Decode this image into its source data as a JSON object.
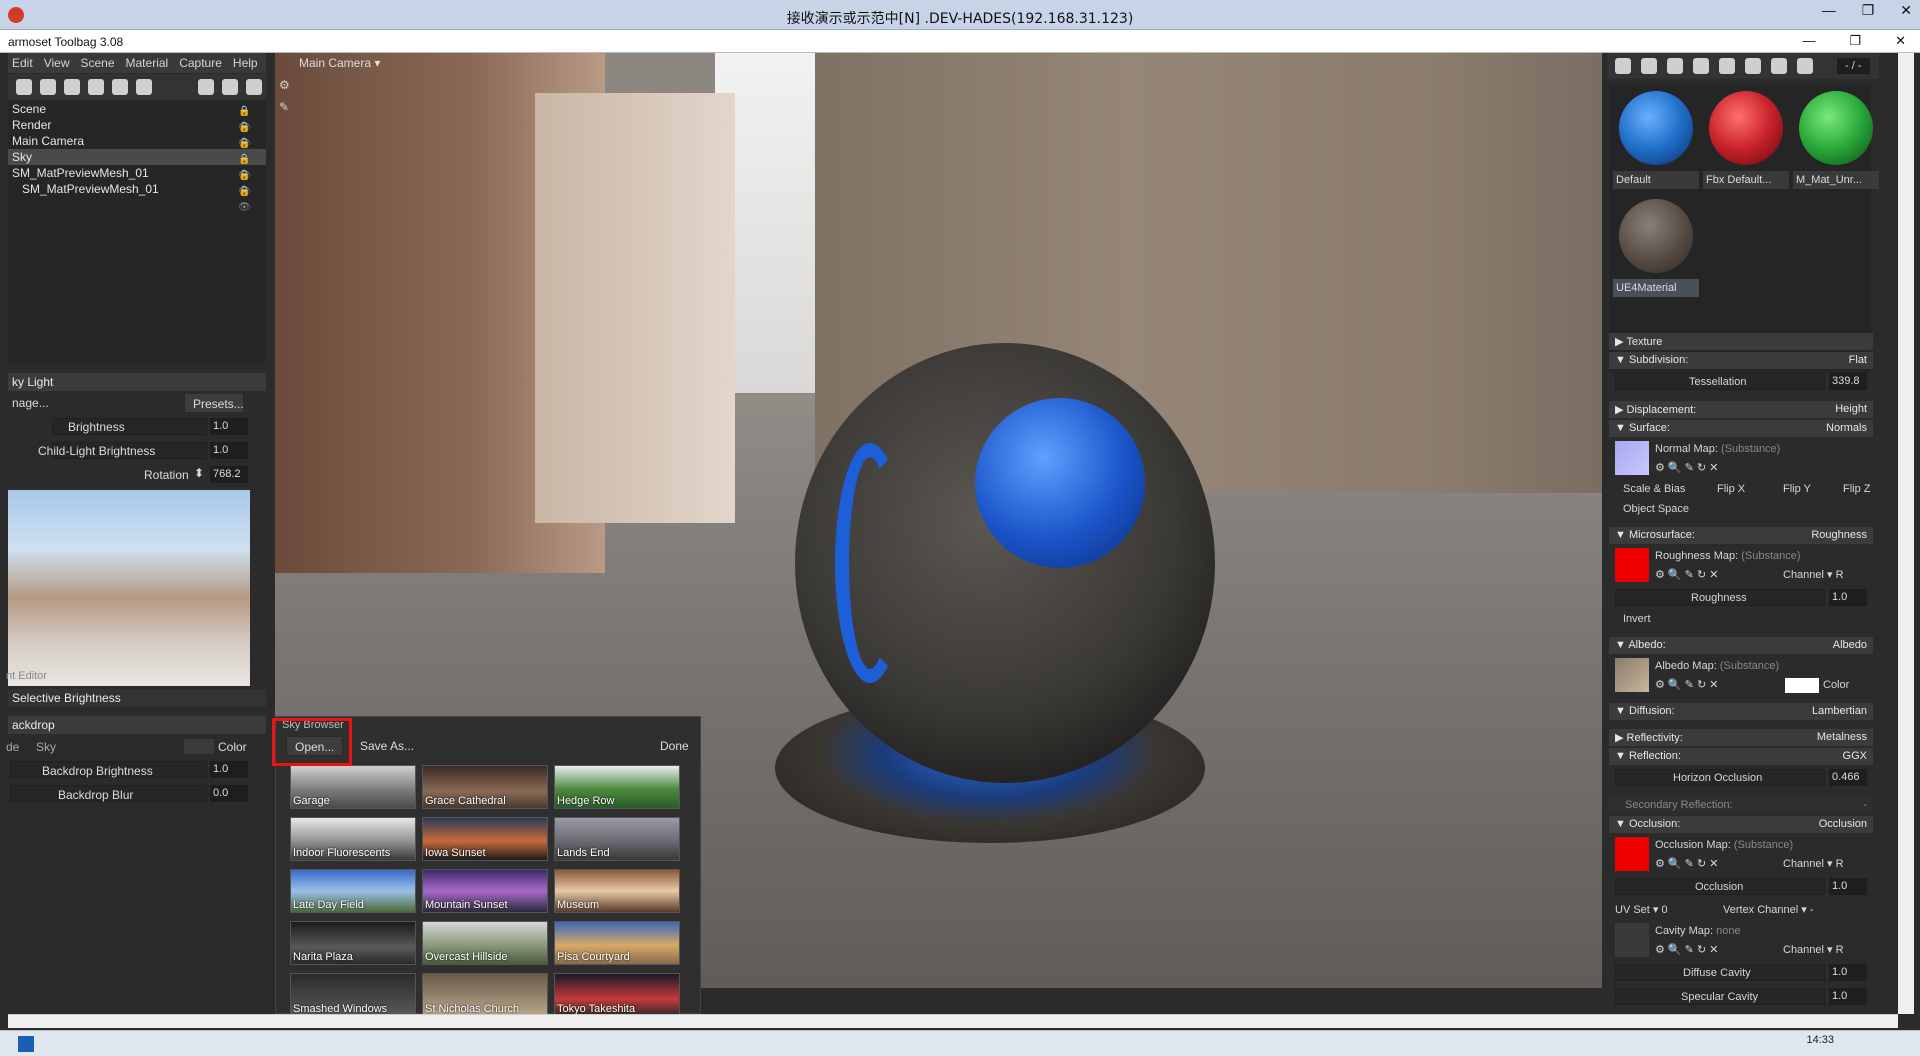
{
  "rdp": {
    "title": "接收演示或示范中[N] .DEV-HADES(192.168.31.123)"
  },
  "app": {
    "title": "armoset Toolbag 3.08"
  },
  "menu": [
    "Edit",
    "View",
    "Scene",
    "Material",
    "Capture",
    "Help"
  ],
  "viewport": {
    "camera": "Main Camera"
  },
  "scene": {
    "items": [
      "Scene",
      "Render",
      "Main Camera",
      "Sky",
      "SM_MatPreviewMesh_01",
      "SM_MatPreviewMesh_01"
    ],
    "selected": 3
  },
  "skylight": {
    "header": "ky Light",
    "image_btn": "nage...",
    "presets_btn": "Presets...",
    "brightness_label": "Brightness",
    "brightness": "1.0",
    "child_label": "Child-Light Brightness",
    "child": "1.0",
    "rotation_label": "Rotation",
    "rotation": "768.2",
    "editor_label": "nt Editor",
    "selective": "Selective Brightness"
  },
  "backdrop": {
    "header": "ackdrop",
    "mode": "de",
    "sky": "Sky",
    "color": "Color",
    "bb_label": "Backdrop Brightness",
    "bb": "1.0",
    "blur_label": "Backdrop Blur",
    "blur": "0.0"
  },
  "skybrowser": {
    "title": "Sky Browser",
    "open": "Open...",
    "saveas": "Save As...",
    "done": "Done",
    "items": [
      "Garage",
      "Grace Cathedral",
      "Hedge Row",
      "Indoor Fluorescents",
      "Iowa Sunset",
      "Lands End",
      "Late Day Field",
      "Mountain Sunset",
      "Museum",
      "Narita Plaza",
      "Overcast Hillside",
      "Pisa Courtyard",
      "Smashed Windows",
      "St Nicholas Church",
      "Tokyo Takeshita"
    ]
  },
  "materials": {
    "ratio": "- / -",
    "items": [
      {
        "name": "Default",
        "color": "#1f6fc8"
      },
      {
        "name": "Fbx Default...",
        "color": "#c8212a"
      },
      {
        "name": "M_Mat_Unr...",
        "color": "#2aa83a"
      },
      {
        "name": "UE4Material",
        "color": "#5a5048"
      }
    ]
  },
  "props": {
    "texture": "Texture",
    "subdivision": {
      "label": "Subdivision:",
      "value": "Flat",
      "tess_label": "Tessellation",
      "tess": "339.8"
    },
    "displacement": {
      "label": "Displacement:",
      "value": "Height"
    },
    "surface": {
      "label": "Surface:",
      "value": "Normals",
      "map": "Normal Map:",
      "sub": "(Substance)",
      "scale": "Scale & Bias",
      "flipx": "Flip X",
      "flipy": "Flip Y",
      "flipz": "Flip Z",
      "objspace": "Object Space"
    },
    "micro": {
      "label": "Microsurface:",
      "value": "Roughness",
      "map": "Roughness Map:",
      "sub": "(Substance)",
      "channel": "Channel",
      "ch": "R",
      "rough_label": "Roughness",
      "rough": "1.0",
      "invert": "Invert"
    },
    "albedo": {
      "label": "Albedo:",
      "value": "Albedo",
      "map": "Albedo Map:",
      "sub": "(Substance)",
      "color": "Color"
    },
    "diffusion": {
      "label": "Diffusion:",
      "value": "Lambertian"
    },
    "reflectivity": {
      "label": "Reflectivity:",
      "value": "Metalness"
    },
    "reflection": {
      "label": "Reflection:",
      "value": "GGX",
      "horizon_label": "Horizon Occlusion",
      "horizon": "0.466"
    },
    "secondary": {
      "label": "Secondary Reflection:",
      "value": "-"
    },
    "occlusion": {
      "label": "Occlusion:",
      "value": "Occlusion",
      "map": "Occlusion Map:",
      "sub": "(Substance)",
      "channel": "Channel",
      "ch": "R",
      "occ_label": "Occlusion",
      "occ": "1.0",
      "uvset": "UV Set",
      "uv": "0",
      "vertex": "Vertex Channel",
      "vc": "-",
      "cavity": "Cavity Map:",
      "none": "none",
      "diffuse_label": "Diffuse Cavity",
      "diffuse": "1.0",
      "spec_label": "Specular Cavity",
      "spec": "1.0"
    }
  },
  "taskbar": {
    "time": "14:33"
  }
}
